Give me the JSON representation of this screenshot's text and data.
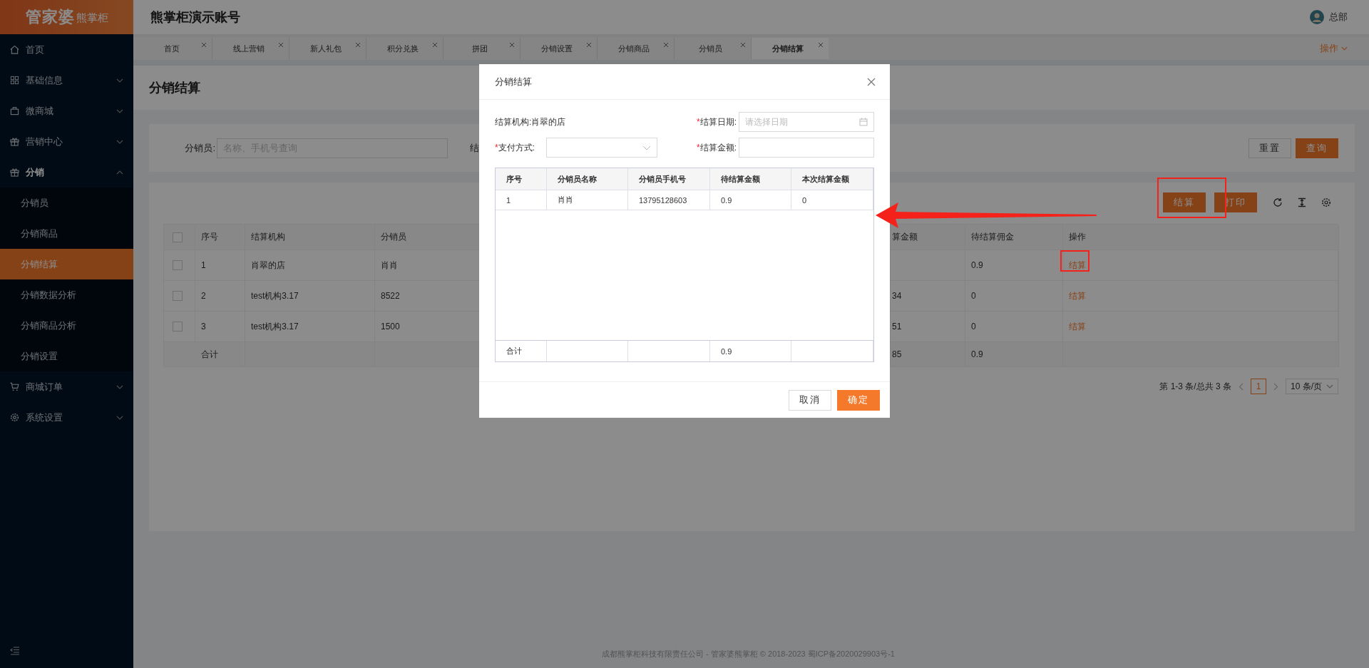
{
  "header": {
    "logo_main": "管家婆",
    "logo_sub": "熊掌柜",
    "title": "熊掌柜演示账号",
    "user": "总部"
  },
  "tabs": [
    {
      "label": "首页",
      "selected": false
    },
    {
      "label": "线上营销",
      "selected": false
    },
    {
      "label": "新人礼包",
      "selected": false
    },
    {
      "label": "积分兑换",
      "selected": false
    },
    {
      "label": "拼团",
      "selected": false
    },
    {
      "label": "分销设置",
      "selected": false
    },
    {
      "label": "分销商品",
      "selected": false
    },
    {
      "label": "分销员",
      "selected": false
    },
    {
      "label": "分销结算",
      "selected": true
    }
  ],
  "tab_menu": "操作",
  "sidebar": {
    "items": [
      {
        "label": "首页",
        "expandable": false,
        "expanded": false
      },
      {
        "label": "基础信息",
        "expandable": true,
        "expanded": false
      },
      {
        "label": "微商城",
        "expandable": true,
        "expanded": false
      },
      {
        "label": "营销中心",
        "expandable": true,
        "expanded": false
      },
      {
        "label": "分销",
        "expandable": true,
        "expanded": true,
        "children": [
          {
            "label": "分销员",
            "selected": false
          },
          {
            "label": "分销商品",
            "selected": false
          },
          {
            "label": "分销结算",
            "selected": true
          },
          {
            "label": "分销数据分析",
            "selected": false
          },
          {
            "label": "分销商品分析",
            "selected": false
          },
          {
            "label": "分销设置",
            "selected": false
          }
        ]
      },
      {
        "label": "商城订单",
        "expandable": true,
        "expanded": false
      },
      {
        "label": "系统设置",
        "expandable": true,
        "expanded": false
      }
    ]
  },
  "page_title": "分销结算",
  "filter": {
    "label": "分销员:",
    "placeholder": "名称、手机号查询",
    "next_label": "结",
    "buttons": [
      {
        "label": "重置",
        "kind": "secondary"
      },
      {
        "label": "查询",
        "kind": "primary"
      }
    ]
  },
  "toolbar": {
    "buttons": [
      "结算",
      "打印"
    ]
  },
  "table": {
    "all_checked": false,
    "columns": [
      "序号",
      "结算机构",
      "分销员",
      "算金额",
      "待结算佣金",
      "操作"
    ],
    "rows": [
      {
        "checked": false,
        "no": "1",
        "org": "肖翠的店",
        "distributor": "肖肖",
        "commission": "0.9",
        "action": "结算"
      },
      {
        "checked": false,
        "no": "2",
        "org": "test机构3.17",
        "distributor": "8522",
        "column_4": "34",
        "commission": "0",
        "action": "结算"
      },
      {
        "checked": false,
        "no": "3",
        "org": "test机构3.17",
        "distributor": "1500",
        "column_4": "51",
        "commission": "0",
        "action": "结算"
      }
    ],
    "total": {
      "label": "合计",
      "column_4": "85",
      "commission": "0.9"
    }
  },
  "pagination": {
    "summary": "第 1-3 条/总共 3 条",
    "pages": [
      {
        "label": "1",
        "selected": true
      }
    ],
    "page_size": "10 条/页"
  },
  "footer": "成都熊掌柜科技有限责任公司 - 管家婆熊掌柜 © 2018-2023 蜀ICP备2020029903号-1",
  "dialog": {
    "title": "分销结算",
    "org_label": "结算机构:",
    "org_value": "肖翠的店",
    "fields": [
      {
        "label": "结算日期:",
        "required_mark": "*",
        "kind": "date",
        "placeholder": "请选择日期"
      },
      {
        "label": "支付方式:",
        "required_mark": "*",
        "kind": "select"
      },
      {
        "label": "结算金额:",
        "required_mark": "*",
        "kind": "text"
      }
    ],
    "table": {
      "columns": [
        "序号",
        "分销员名称",
        "分销员手机号",
        "待结算金额",
        "本次结算金额"
      ],
      "rows": [
        {
          "no": "1",
          "name": "肖肖",
          "phone": "13795128603",
          "pending": "0.9",
          "current": "0"
        }
      ],
      "total": {
        "label": "合计",
        "pending": "0.9"
      }
    },
    "buttons": [
      {
        "label": "取消",
        "kind": "secondary"
      },
      {
        "label": "确定",
        "kind": "primary"
      }
    ]
  }
}
